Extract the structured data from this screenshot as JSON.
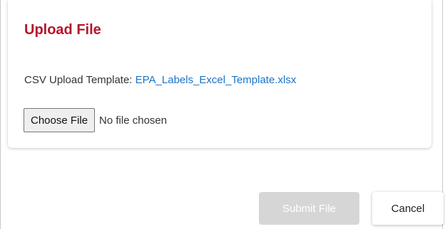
{
  "dialog": {
    "title": "Upload File",
    "template": {
      "label": "CSV Upload Template: ",
      "link_text": "EPA_Labels_Excel_Template.xlsx"
    },
    "file_input": {
      "button_label": "Choose File",
      "status": "No file chosen"
    },
    "footer": {
      "submit_label": "Submit File",
      "submit_disabled": true,
      "cancel_label": "Cancel"
    }
  },
  "colors": {
    "title": "#b5152b",
    "link": "#1a73c9",
    "disabled_button": "#d6d6d6"
  }
}
